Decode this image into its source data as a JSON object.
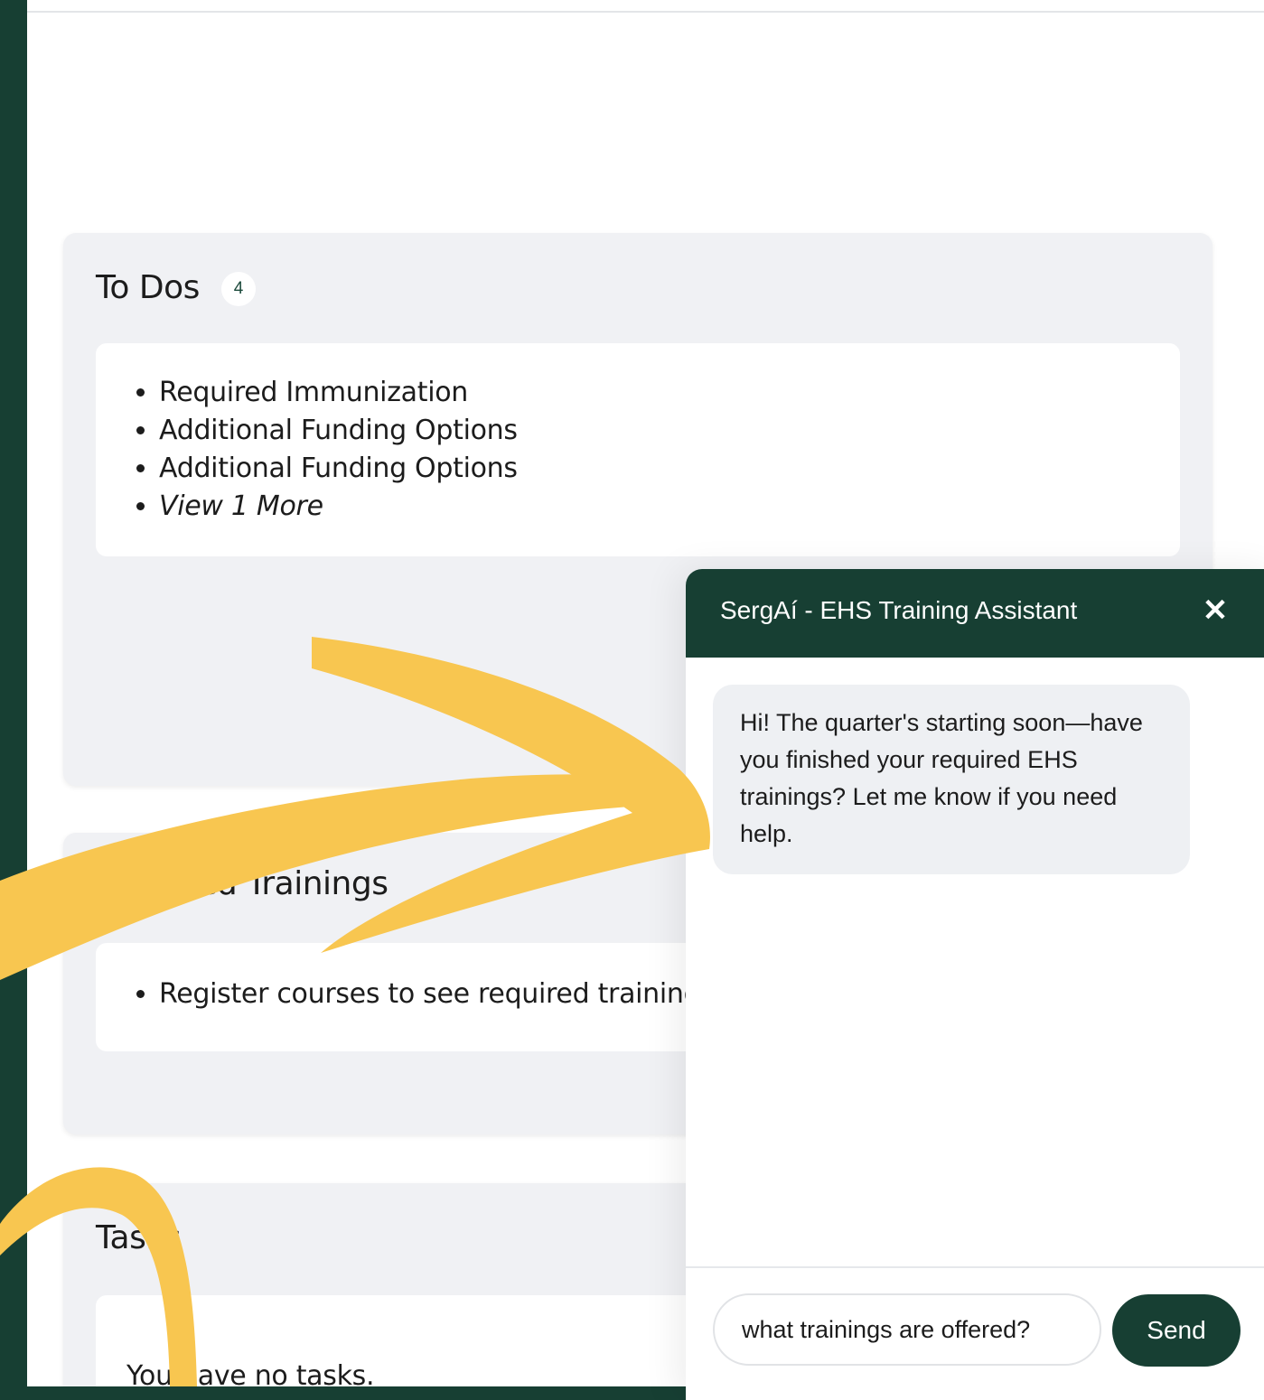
{
  "todos": {
    "title": "To Dos",
    "count": "4",
    "items": [
      "Required Immunization",
      "Additional Funding Options",
      "Additional Funding Options"
    ],
    "more_label": "View 1 More"
  },
  "required_trainings": {
    "title": "Required Trainings",
    "items": [
      "Register courses to see required trainings"
    ]
  },
  "tasks": {
    "title": "Tasks",
    "empty_text": "You have no tasks."
  },
  "chat": {
    "title": "SergAí - EHS Training Assistant",
    "close_symbol": "✕",
    "messages": [
      {
        "sender": "assistant",
        "text": "Hi! The quarter's starting soon—have you finished your required EHS trainings? Let me know if you need help."
      }
    ],
    "input_value": "what trainings are offered?",
    "send_label": "Send"
  },
  "colors": {
    "brand_green": "#173f33",
    "card_bg": "#f0f1f4",
    "arrow_yellow": "#f8c650"
  }
}
